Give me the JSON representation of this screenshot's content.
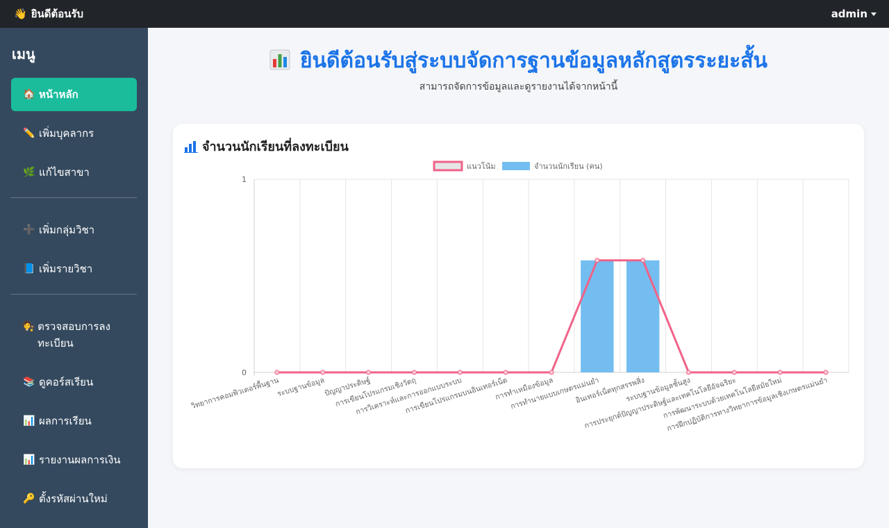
{
  "topbar": {
    "brand_icon": "waving-hand-icon",
    "brand_label": "ยินดีต้อนรับ",
    "user_label": "admin"
  },
  "sidebar": {
    "title": "เมนู",
    "groups": [
      [
        {
          "icon": "house-icon",
          "label": "หน้าหลัก",
          "active": true
        },
        {
          "icon": "pencil-icon",
          "label": "เพิ่มบุคลากร"
        },
        {
          "icon": "herb-icon",
          "label": "แก้ไขสาขา"
        }
      ],
      [
        {
          "icon": "plus-icon",
          "label": "เพิ่มกลุ่มวิชา"
        },
        {
          "icon": "book-icon",
          "label": "เพิ่มรายวิชา"
        }
      ],
      [
        {
          "icon": "judge-icon",
          "label": "ตรวจสอบการลงทะเบียน"
        },
        {
          "icon": "books-icon",
          "label": "ดูคอร์สเรียน"
        },
        {
          "icon": "bar-chart-icon",
          "label": "ผลการเรียน"
        },
        {
          "icon": "bar-chart-icon",
          "label": "รายงานผลการเงิน"
        },
        {
          "icon": "key-icon",
          "label": "ตั้งรหัสผ่านใหม่"
        }
      ]
    ]
  },
  "main": {
    "title": "ยินดีต้อนรับสู่ระบบจัดการฐานข้อมูลหลักสูตรระยะสั้น",
    "subtitle": "สามารถจัดการข้อมูลและดูรายงานได้จากหน้านี้",
    "card_title": "จำนวนนักเรียนที่ลงทะเบียน"
  },
  "colors": {
    "accent": "#1abc9c",
    "sidebar": "#34495e",
    "topbar": "#212529",
    "title": "#1a73e8",
    "bar": "#74bdf0",
    "line": "#f06388"
  },
  "chart_data": {
    "type": "bar",
    "categories": [
      "วิทยาการคอมพิวเตอร์พื้นฐาน",
      "ระบบฐานข้อมูล",
      "ปัญญาประดิษฐ์",
      "การเขียนโปรแกรมเชิงวัตถุ",
      "การวิเคราะห์และการออกแบบระบบ",
      "การเขียนโปรแกรมบนอินเทอร์เน็ต",
      "การทำเหมืองข้อมูล",
      "การทำนายแบบเกษตรแม่นยำ",
      "อินเทอร์เน็ตทุกสรรพสิ่ง",
      "ระบบฐานข้อมูลชั้นสูง",
      "การประยุกต์ปัญญาประดิษฐ์และเทคโนโลยีอัจฉริยะ",
      "การพัฒนาระบบด้วยเทคโนโลยีสมัยใหม่",
      "การฝึกปฏิบัติการทางวิทยาการข้อมูลเชิงเกษตรแม่นยำ"
    ],
    "series": [
      {
        "name": "แนวโน้ม",
        "kind": "line",
        "values": [
          0,
          0,
          0,
          0,
          0,
          0,
          0,
          0.58,
          0.58,
          0,
          0,
          0,
          0
        ]
      },
      {
        "name": "จำนวนนักเรียน (คน)",
        "kind": "bar",
        "values": [
          0,
          0,
          0,
          0,
          0,
          0,
          0,
          0.58,
          0.58,
          0,
          0,
          0,
          0
        ]
      }
    ],
    "yticks": [
      "0",
      "1"
    ],
    "ylim": [
      0,
      1
    ],
    "grid": true,
    "legend": "top"
  }
}
